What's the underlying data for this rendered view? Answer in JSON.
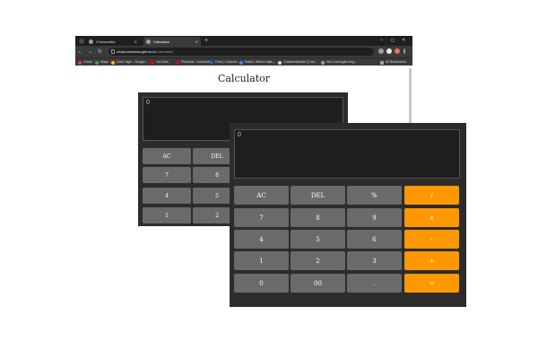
{
  "browser": {
    "tabs": [
      {
        "label": "Chatsumbia"
      },
      {
        "label": "Calculator"
      }
    ],
    "new_tab": "+",
    "window_controls": {
      "minimize": "–",
      "maximize": "◻",
      "close": "✕"
    },
    "nav": {
      "back": "←",
      "forward": "→",
      "reload": "↻",
      "info": "☰"
    },
    "address": {
      "host": "chatsumbiasea.github.io",
      "path": "/Calculator/"
    },
    "bookmarks": [
      {
        "label": "Gmail",
        "color": "#ea4335"
      },
      {
        "label": "Maps",
        "color": "#34a853"
      },
      {
        "label": "Drive Tape - Google...",
        "color": "#fbbc04"
      },
      {
        "label": "YouTube",
        "color": "#ff0000"
      },
      {
        "label": "Pinterest - Indonesia",
        "color": "#e60023"
      },
      {
        "label": "Feed | LinkedIn",
        "color": "#0a66c2"
      },
      {
        "label": "Kaltim: Where data...",
        "color": "#4285f4"
      },
      {
        "label": "Chatsumbia/del (Chat...",
        "color": "#9aa0a6"
      },
      {
        "label": "Info Lowongan Keg...",
        "color": "#9aa0a6"
      }
    ],
    "all_bookmarks": "All Bookmarks"
  },
  "page": {
    "title": "Calculator"
  },
  "calc_back": {
    "display": "0",
    "buttons": [
      "AC",
      "DEL",
      "7",
      "8",
      "4",
      "5",
      "1",
      "2"
    ]
  },
  "calc_front": {
    "display": "0",
    "buttons": [
      {
        "label": "AC",
        "kind": "fn"
      },
      {
        "label": "DEL",
        "kind": "fn"
      },
      {
        "label": "%",
        "kind": "fn"
      },
      {
        "label": "/",
        "kind": "op"
      },
      {
        "label": "7",
        "kind": "num"
      },
      {
        "label": "8",
        "kind": "num"
      },
      {
        "label": "9",
        "kind": "num"
      },
      {
        "label": "x",
        "kind": "op"
      },
      {
        "label": "4",
        "kind": "num"
      },
      {
        "label": "5",
        "kind": "num"
      },
      {
        "label": "6",
        "kind": "num"
      },
      {
        "label": "-",
        "kind": "op"
      },
      {
        "label": "1",
        "kind": "num"
      },
      {
        "label": "2",
        "kind": "num"
      },
      {
        "label": "3",
        "kind": "num"
      },
      {
        "label": "+",
        "kind": "op"
      },
      {
        "label": "0",
        "kind": "num"
      },
      {
        "label": "00",
        "kind": "num"
      },
      {
        "label": ".",
        "kind": "num"
      },
      {
        "label": "=",
        "kind": "op"
      }
    ]
  },
  "colors": {
    "accent_operator": "#ff9800",
    "button_gray": "#6a6a6a",
    "calc_body": "#2c2c2c",
    "display_bg": "#1e1e1e"
  }
}
